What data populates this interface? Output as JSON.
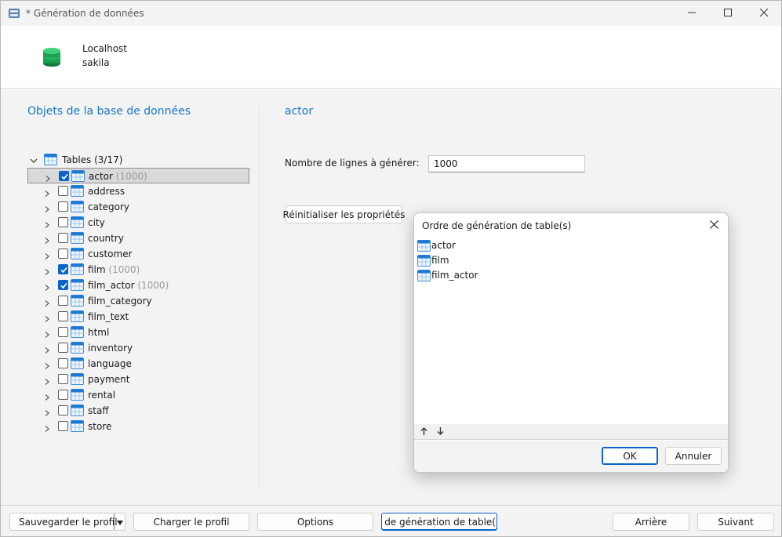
{
  "window": {
    "title": "* Génération de données",
    "controls": [
      "minimize-icon",
      "maximize-icon",
      "close-icon"
    ]
  },
  "connection": {
    "host": "Localhost",
    "database": "sakila",
    "icon": "database-icon"
  },
  "left_panel": {
    "title": "Objets de la base de données",
    "root": {
      "label": "Tables (3/17)",
      "expanded": true
    },
    "tables": [
      {
        "name": "actor",
        "checked": true,
        "count": "(1000)",
        "selected": true
      },
      {
        "name": "address",
        "checked": false,
        "count": "",
        "selected": false
      },
      {
        "name": "category",
        "checked": false,
        "count": "",
        "selected": false
      },
      {
        "name": "city",
        "checked": false,
        "count": "",
        "selected": false
      },
      {
        "name": "country",
        "checked": false,
        "count": "",
        "selected": false
      },
      {
        "name": "customer",
        "checked": false,
        "count": "",
        "selected": false
      },
      {
        "name": "film",
        "checked": true,
        "count": "(1000)",
        "selected": false
      },
      {
        "name": "film_actor",
        "checked": true,
        "count": "(1000)",
        "selected": false
      },
      {
        "name": "film_category",
        "checked": false,
        "count": "",
        "selected": false
      },
      {
        "name": "film_text",
        "checked": false,
        "count": "",
        "selected": false
      },
      {
        "name": "html",
        "checked": false,
        "count": "",
        "selected": false
      },
      {
        "name": "inventory",
        "checked": false,
        "count": "",
        "selected": false
      },
      {
        "name": "language",
        "checked": false,
        "count": "",
        "selected": false
      },
      {
        "name": "payment",
        "checked": false,
        "count": "",
        "selected": false
      },
      {
        "name": "rental",
        "checked": false,
        "count": "",
        "selected": false
      },
      {
        "name": "staff",
        "checked": false,
        "count": "",
        "selected": false
      },
      {
        "name": "store",
        "checked": false,
        "count": "",
        "selected": false
      }
    ]
  },
  "right_panel": {
    "title": "actor",
    "rows_label": "Nombre de lignes à générer:",
    "rows_value": "1000",
    "reset_label": "Réinitialiser les propriétés"
  },
  "dialog": {
    "title": "Ordre de génération de table(s)",
    "items": [
      "actor",
      "film",
      "film_actor"
    ],
    "ok_label": "OK",
    "cancel_label": "Annuler"
  },
  "footer": {
    "save_label": "Sauvegarder le profil",
    "load_label": "Charger le profil",
    "options_label": "Options",
    "order_label": "rdre de génération de table(",
    "back_label": "Arrière",
    "next_label": "Suivant"
  },
  "colors": {
    "accent": "#1777c6",
    "checkbox": "#0a64c8",
    "db_icon": "#1fa055"
  }
}
